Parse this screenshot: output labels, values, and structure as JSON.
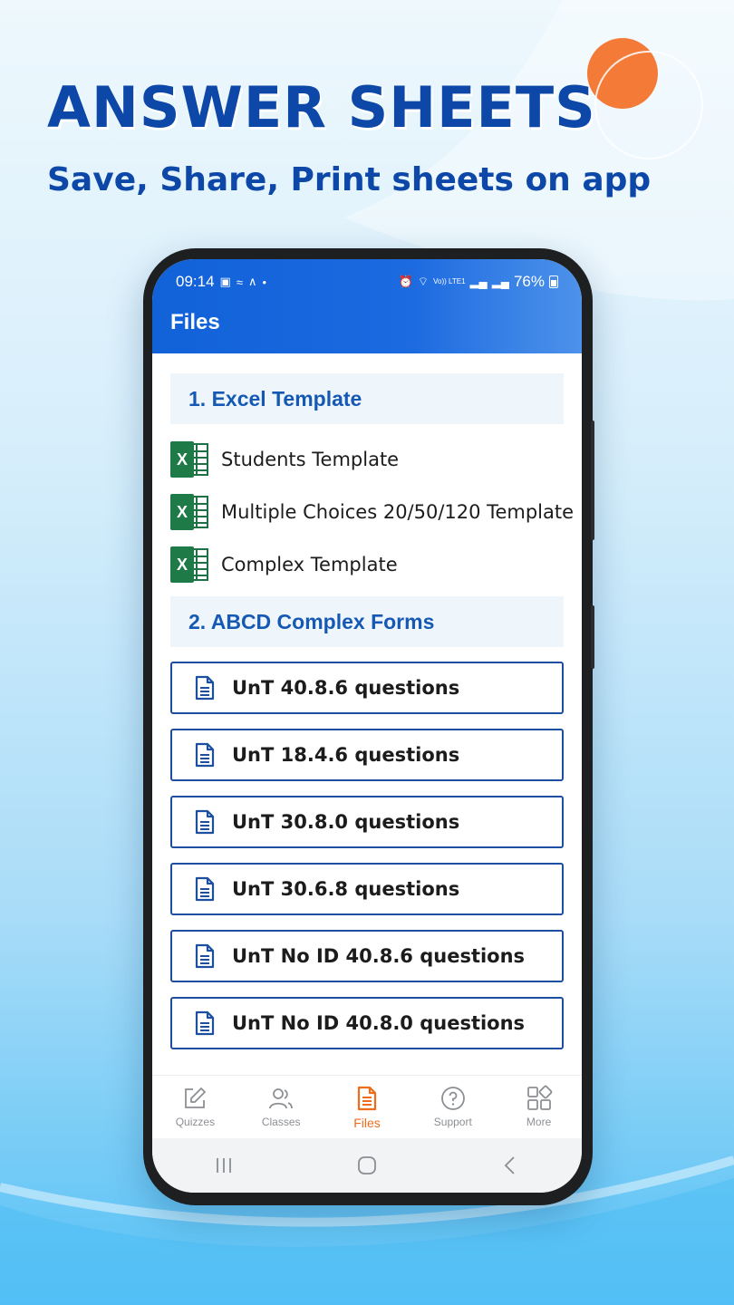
{
  "promo": {
    "headline": "ANSWER SHEETS",
    "subline": "Save, Share, Print sheets on app"
  },
  "status_bar": {
    "time": "09:14",
    "volte": "Vo)) LTE1",
    "battery": "76%"
  },
  "app": {
    "title": "Files",
    "sections": [
      {
        "title": "1. Excel Template",
        "items": [
          {
            "label": "Students Template",
            "icon": "excel-icon"
          },
          {
            "label": "Multiple Choices 20/50/120 Template",
            "icon": "excel-icon"
          },
          {
            "label": "Complex Template",
            "icon": "excel-icon"
          }
        ]
      },
      {
        "title": "2. ABCD Complex Forms",
        "items": [
          {
            "label": "UnT 40.8.6 questions",
            "icon": "document-icon"
          },
          {
            "label": "UnT 18.4.6 questions",
            "icon": "document-icon"
          },
          {
            "label": "UnT 30.8.0 questions",
            "icon": "document-icon"
          },
          {
            "label": "UnT 30.6.8 questions",
            "icon": "document-icon"
          },
          {
            "label": "UnT No ID 40.8.6 questions",
            "icon": "document-icon"
          },
          {
            "label": "UnT No ID 40.8.0 questions",
            "icon": "document-icon"
          }
        ]
      }
    ],
    "excel_badge": "X",
    "bottom_nav": [
      {
        "label": "Quizzes",
        "icon": "pencil-square-icon"
      },
      {
        "label": "Classes",
        "icon": "users-icon"
      },
      {
        "label": "Files",
        "icon": "file-icon",
        "active": true
      },
      {
        "label": "Support",
        "icon": "question-circle-icon"
      },
      {
        "label": "More",
        "icon": "grid-icon"
      }
    ]
  },
  "colors": {
    "brand_blue": "#0d48a8",
    "appbar_blue": "#1161d8",
    "active_orange": "#ef6c1b",
    "excel_green": "#1e7a46"
  }
}
